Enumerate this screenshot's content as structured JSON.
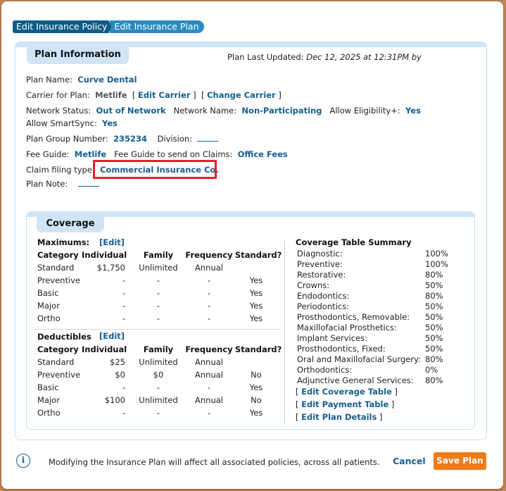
{
  "tabs": [
    "Edit Insurance Policy",
    "Edit Insurance Plan"
  ],
  "plan_info": {
    "title": "Plan Information",
    "last_updated_label": "Plan Last Updated:",
    "last_updated_value": "Dec 12, 2025 at 12:31PM by",
    "plan_name_label": "Plan Name:",
    "plan_name": "Curve Dental",
    "carrier_label": "Carrier for Plan:",
    "carrier": "Metlife",
    "edit_carrier": "Edit Carrier",
    "change_carrier": "Change Carrier",
    "network_status_label": "Network Status:",
    "network_status": "Out of Network",
    "network_name_label": "Network Name:",
    "network_name": "Non-Participating",
    "allow_elig_label": "Allow Eligibility+:",
    "allow_elig": "Yes",
    "allow_smartsync_label": "Allow SmartSync:",
    "allow_smartsync": "Yes",
    "group_number_label": "Plan Group Number:",
    "group_number": "235234",
    "division_label": "Division:",
    "fee_guide_label": "Fee Guide:",
    "fee_guide": "Metlife",
    "fee_guide_claims_label": "Fee Guide to send on Claims:",
    "fee_guide_claims": "Office Fees",
    "claim_filing_label": "Claim filing type:",
    "claim_filing": "Commercial Insurance Co.",
    "plan_note_label": "Plan Note:"
  },
  "coverage": {
    "title": "Coverage",
    "maximums_label": "Maximums:",
    "deductibles_label": "Deductibles",
    "edit_label": "[Edit]",
    "headers": [
      "Category",
      "Individual",
      "Family",
      "Frequency",
      "Standard?"
    ],
    "maximums": [
      [
        "Standard",
        "$1,750",
        "Unlimited",
        "Annual",
        ""
      ],
      [
        "Preventive",
        "-",
        "-",
        "-",
        "Yes"
      ],
      [
        "Basic",
        "-",
        "-",
        "-",
        "Yes"
      ],
      [
        "Major",
        "-",
        "-",
        "-",
        "Yes"
      ],
      [
        "Ortho",
        "-",
        "-",
        "-",
        "Yes"
      ]
    ],
    "deductibles": [
      [
        "Standard",
        "$25",
        "Unlimited",
        "Annual",
        ""
      ],
      [
        "Preventive",
        "$0",
        "$0",
        "Annual",
        "No"
      ],
      [
        "Basic",
        "-",
        "-",
        "-",
        "Yes"
      ],
      [
        "Major",
        "$100",
        "Unlimited",
        "Annual",
        "No"
      ],
      [
        "Ortho",
        "-",
        "-",
        "-",
        "Yes"
      ]
    ],
    "summary_title": "Coverage Table Summary",
    "summary": [
      [
        "Diagnostic:",
        "100%"
      ],
      [
        "Preventive:",
        "100%"
      ],
      [
        "Restorative:",
        "80%"
      ],
      [
        "Crowns:",
        "50%"
      ],
      [
        "Endodontics:",
        "80%"
      ],
      [
        "Periodontics:",
        "50%"
      ],
      [
        "Prosthodontics, Removable:",
        "50%"
      ],
      [
        "Maxillofacial Prosthetics:",
        "50%"
      ],
      [
        "Implant Services:",
        "50%"
      ],
      [
        "Prosthodontics, Fixed:",
        "50%"
      ],
      [
        "Oral and Maxillofacial Surgery:",
        "80%"
      ],
      [
        "Orthodontics:",
        "0%"
      ],
      [
        "Adjunctive General Services:",
        "80%"
      ]
    ],
    "links": [
      "Edit Coverage Table",
      "Edit Payment Table",
      "Edit Plan Details"
    ]
  },
  "footer": {
    "info_icon": "i",
    "message": "Modifying the Insurance Plan will affect all associated policies, across all patients.",
    "cancel": "Cancel",
    "save": "Save Plan"
  },
  "colors": {
    "accent": "#145f8f",
    "save_button": "#ee7a1a",
    "highlight": "#e5202c",
    "section_bg": "#cfe4f7"
  }
}
